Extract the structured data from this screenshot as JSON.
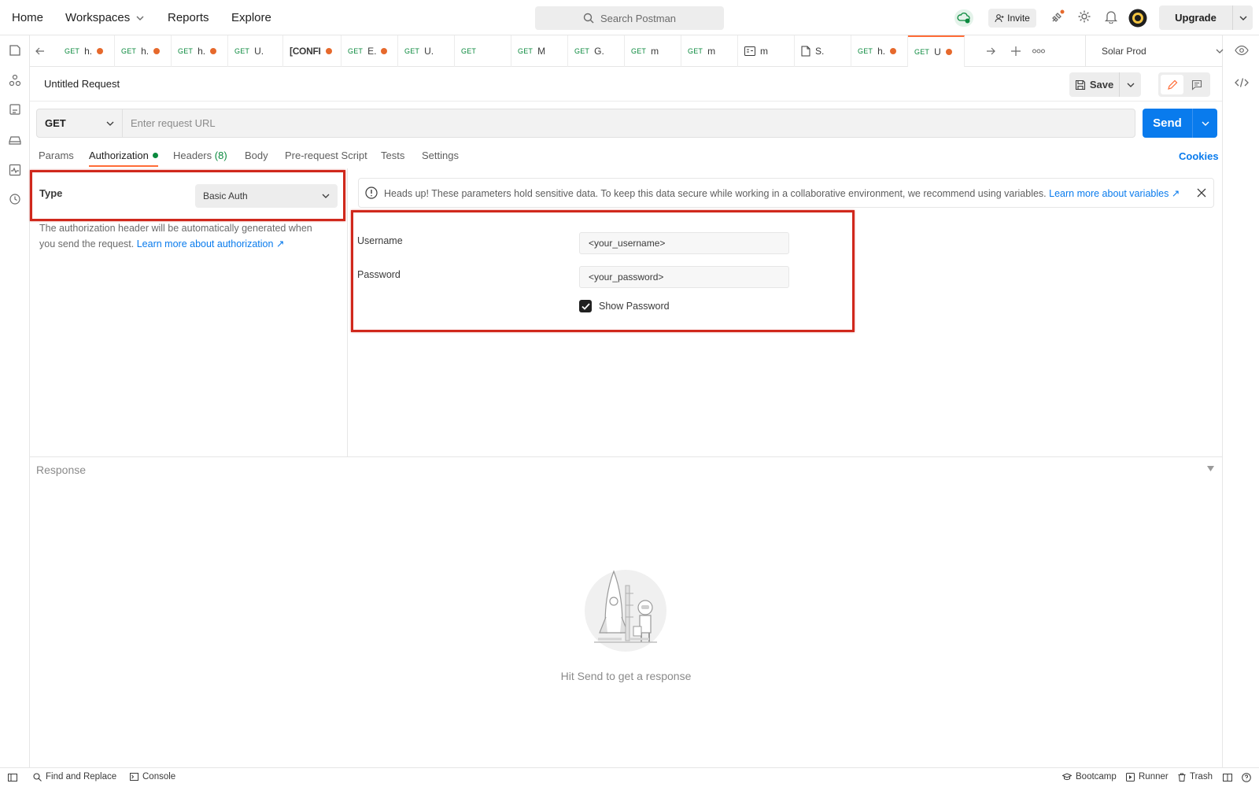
{
  "nav": {
    "home": "Home",
    "workspaces": "Workspaces",
    "reports": "Reports",
    "explore": "Explore",
    "search_placeholder": "Search Postman",
    "invite": "Invite",
    "upgrade": "Upgrade"
  },
  "tabs": [
    {
      "method": "GET",
      "title": "h.",
      "unsaved": true
    },
    {
      "method": "GET",
      "title": "h.",
      "unsaved": true
    },
    {
      "method": "GET",
      "title": "h.",
      "unsaved": true
    },
    {
      "method": "GET",
      "title": "U.",
      "unsaved": false
    },
    {
      "method": "",
      "title": "[CONFI",
      "unsaved": true
    },
    {
      "method": "GET",
      "title": "E.",
      "unsaved": true
    },
    {
      "method": "GET",
      "title": "U.",
      "unsaved": false
    },
    {
      "method": "GET",
      "title": "",
      "unsaved": false
    },
    {
      "method": "GET",
      "title": "M",
      "unsaved": false
    },
    {
      "method": "GET",
      "title": "G.",
      "unsaved": false
    },
    {
      "method": "GET",
      "title": "m",
      "unsaved": false
    },
    {
      "method": "GET",
      "title": "m",
      "unsaved": false
    },
    {
      "method": "",
      "title": "m",
      "unsaved": false
    },
    {
      "method": "",
      "title": "S.",
      "unsaved": false
    },
    {
      "method": "GET",
      "title": "h.",
      "unsaved": true
    },
    {
      "method": "GET",
      "title": "U",
      "unsaved": true
    }
  ],
  "environment": "Solar Prod",
  "request": {
    "title": "Untitled Request",
    "save": "Save",
    "method": "GET",
    "url_placeholder": "Enter request URL",
    "send": "Send"
  },
  "subtabs": {
    "params": "Params",
    "authorization": "Authorization",
    "headers": "Headers",
    "headers_count": "(8)",
    "body": "Body",
    "prerequest": "Pre-request Script",
    "tests": "Tests",
    "settings": "Settings",
    "cookies": "Cookies"
  },
  "auth": {
    "type_label": "Type",
    "type_value": "Basic Auth",
    "description": "The authorization header will be automatically generated when you send the request.",
    "learn_more": "Learn more about authorization ↗",
    "headsup": "Heads up! These parameters hold sensitive data. To keep this data secure while working in a collaborative environment, we recommend using variables.",
    "headsup_link": "Learn more about variables ↗",
    "username_label": "Username",
    "username_value": "<your_username>",
    "password_label": "Password",
    "password_value": "<your_password>",
    "show_password": "Show Password",
    "show_password_checked": true
  },
  "response": {
    "label": "Response",
    "empty_text": "Hit Send to get a response"
  },
  "footer": {
    "find_replace": "Find and Replace",
    "console": "Console",
    "bootcamp": "Bootcamp",
    "runner": "Runner",
    "trash": "Trash"
  },
  "colors": {
    "accent": "#ff6c37",
    "send": "#097bed",
    "get_method": "#0b8a3e",
    "unsaved_dot": "#e6692c",
    "highlight_box": "#d0281c"
  }
}
